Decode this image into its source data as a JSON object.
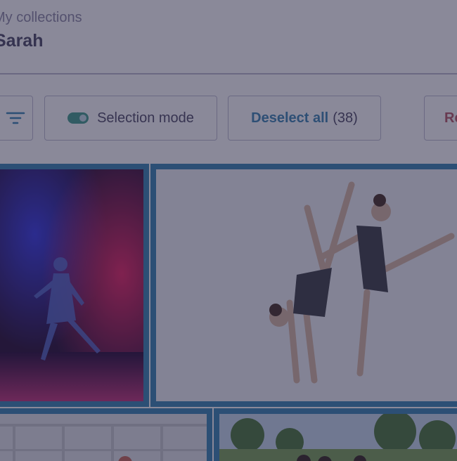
{
  "header": {
    "breadcrumb": "My collections",
    "title": "Sarah"
  },
  "toolbar": {
    "filter_icon": "filter-icon",
    "selection_mode_label": "Selection mode",
    "selection_mode_on": true,
    "deselect_label": "Deselect all",
    "deselect_count": "(38)",
    "next_button_label": "Re"
  },
  "colors": {
    "accent": "#3b87b4",
    "toggle_on": "#46a08e",
    "danger": "#b95a6a"
  },
  "photos": [
    {
      "subject": "dancer in colored smoke",
      "selected": true
    },
    {
      "subject": "two gymnasts in leotards",
      "selected": true
    },
    {
      "subject": "outdoor fence scene",
      "selected": true
    },
    {
      "subject": "people outdoors with trees",
      "selected": true
    }
  ]
}
